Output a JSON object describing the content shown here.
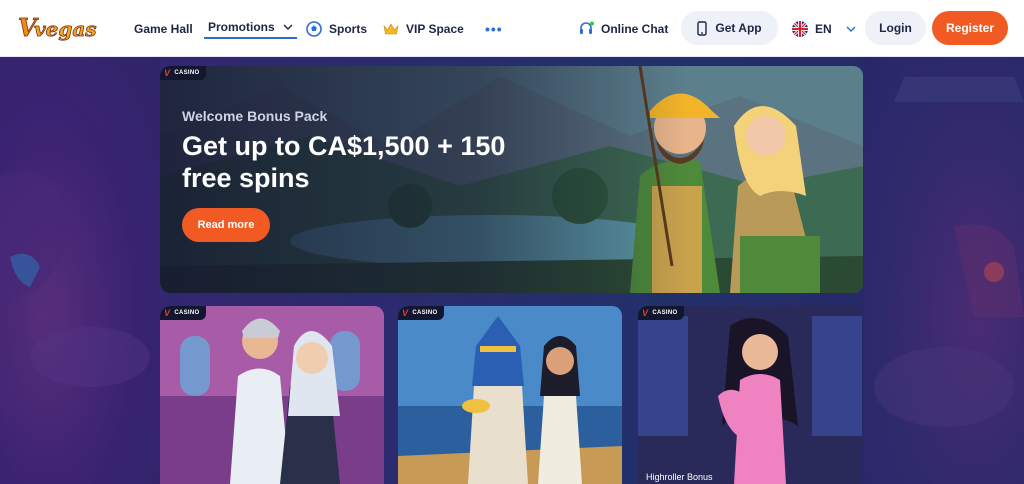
{
  "header": {
    "logo_text": "V.vegas",
    "nav": {
      "game_hall": "Game Hall",
      "promotions": "Promotions",
      "sports": "Sports",
      "vip_space": "VIP Space",
      "more": "•••"
    },
    "online_chat": "Online Chat",
    "get_app": "Get App",
    "language": "EN",
    "login": "Login",
    "register": "Register"
  },
  "hero": {
    "badge": "CASINO",
    "subtitle": "Welcome Bonus Pack",
    "title": "Get up to CA$1,500 + 150 free spins",
    "cta": "Read more"
  },
  "cards": [
    {
      "badge": "CASINO",
      "caption": ""
    },
    {
      "badge": "CASINO",
      "caption": ""
    },
    {
      "badge": "CASINO",
      "caption": "Highroller Bonus"
    }
  ],
  "colors": {
    "accent": "#f25a24",
    "nav_underline": "#2b6cd6",
    "text_dark": "#1f2544",
    "pill_bg": "#eef1f8"
  }
}
